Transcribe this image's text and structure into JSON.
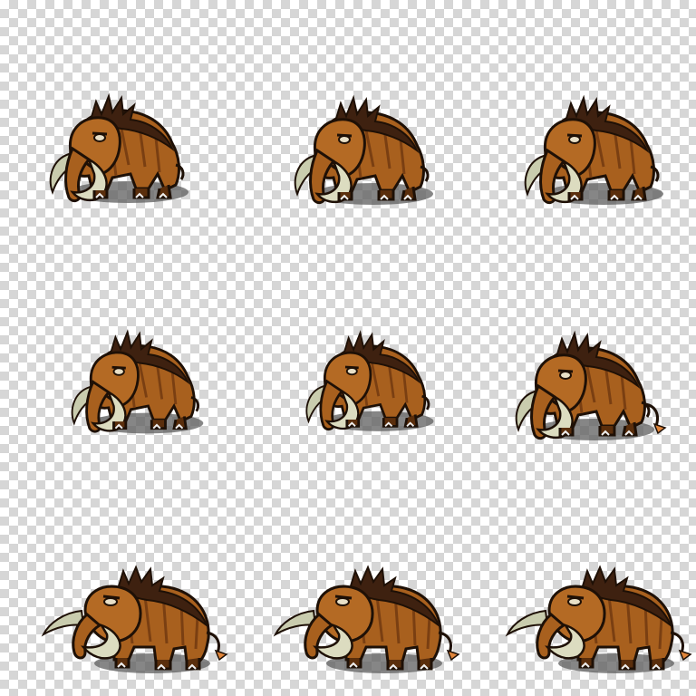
{
  "sprite_sheet": {
    "rows": 3,
    "columns": 3,
    "background": "transparency-checkerboard",
    "checker_colors": [
      "#ffffff",
      "#d6d6d6"
    ],
    "sprite_subject": "woolly-mammoth",
    "palette": {
      "fur": "#a8601e",
      "fur_dark": "#5a2e0c",
      "fur_shade": "#7a3f12",
      "mane": "#3e2110",
      "tusk": "#dcdcc0",
      "tusk_shade": "#a9ab8c",
      "outline": "#1e1006",
      "shadow": "#5e5e5e",
      "tail_tuft": "#e0853a"
    },
    "rows_meta": [
      {
        "pose": "idle"
      },
      {
        "pose": "idle-turn"
      },
      {
        "pose": "walk"
      }
    ]
  }
}
